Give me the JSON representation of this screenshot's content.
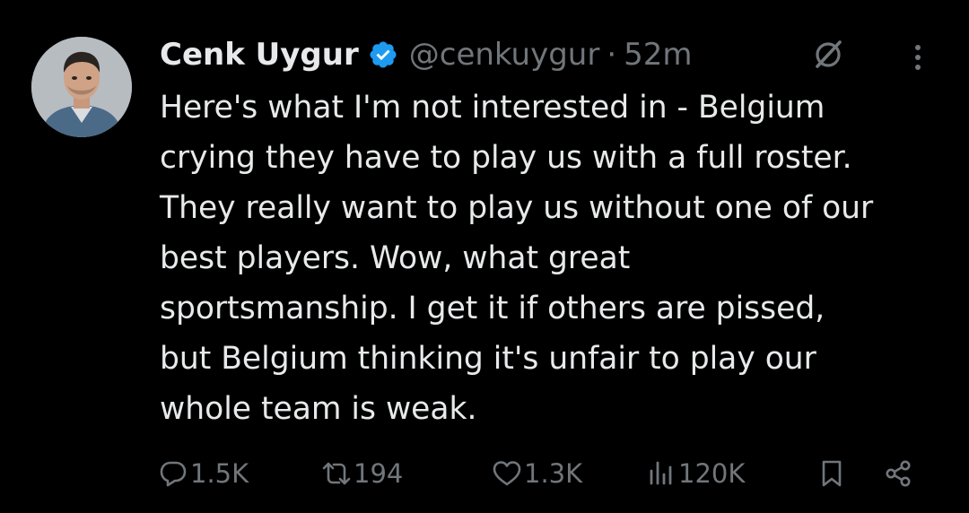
{
  "tweet": {
    "author_name": "Cenk Uygur",
    "handle": "@cenkuygur",
    "separator": "·",
    "time": "52m",
    "text": "Here's what I'm not interested in - Belgium\ncrying they have to play us with a full roster.\nThey really want to play us without one of our\nbest players. Wow, what great\nsportsmanship. I get it if others are pissed,\nbut Belgium thinking it's unfair to play our\nwhole team is weak."
  },
  "actions": {
    "replies": "1.5K",
    "reposts": "194",
    "likes": "1.3K",
    "views": "120K"
  },
  "icons": {
    "verified": "verified-badge-icon",
    "grok": "grok-icon",
    "more": "more-vertical-icon",
    "reply": "reply-icon",
    "repost": "repost-icon",
    "like": "heart-icon",
    "views": "views-icon",
    "bookmark": "bookmark-icon",
    "share": "share-icon"
  },
  "colors": {
    "background": "#000000",
    "text": "#e7e9ea",
    "muted": "#71767b",
    "verified": "#1d9bf0"
  }
}
